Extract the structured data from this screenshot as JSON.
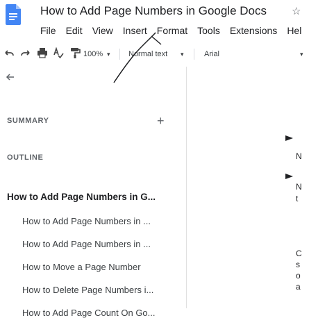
{
  "app": {
    "title": "How to Add Page Numbers in Google Docs",
    "brand_color": "#4285f4"
  },
  "menu": [
    "File",
    "Edit",
    "View",
    "Insert",
    "Format",
    "Tools",
    "Extensions",
    "Hel"
  ],
  "toolbar": {
    "zoom": "100%",
    "style": "Normal text",
    "font": "Arial",
    "icons": [
      "undo-icon",
      "redo-icon",
      "print-icon",
      "spellcheck-icon",
      "paint-format-icon"
    ]
  },
  "sidebar": {
    "summary_label": "SUMMARY",
    "outline_label": "OUTLINE",
    "outline": [
      {
        "level": 1,
        "text": "How to Add Page Numbers in G..."
      },
      {
        "level": 2,
        "text": "How to Add Page Numbers in ..."
      },
      {
        "level": 2,
        "text": "How to Add Page Numbers in ..."
      },
      {
        "level": 2,
        "text": "How to Move a Page Number"
      },
      {
        "level": 2,
        "text": "How to Delete Page Numbers i..."
      },
      {
        "level": 2,
        "text": "How to Add Page Count On Go..."
      }
    ]
  },
  "doc_edge": {
    "chars": [
      "N",
      "N",
      "t",
      "C",
      "s",
      "o",
      "a"
    ]
  }
}
